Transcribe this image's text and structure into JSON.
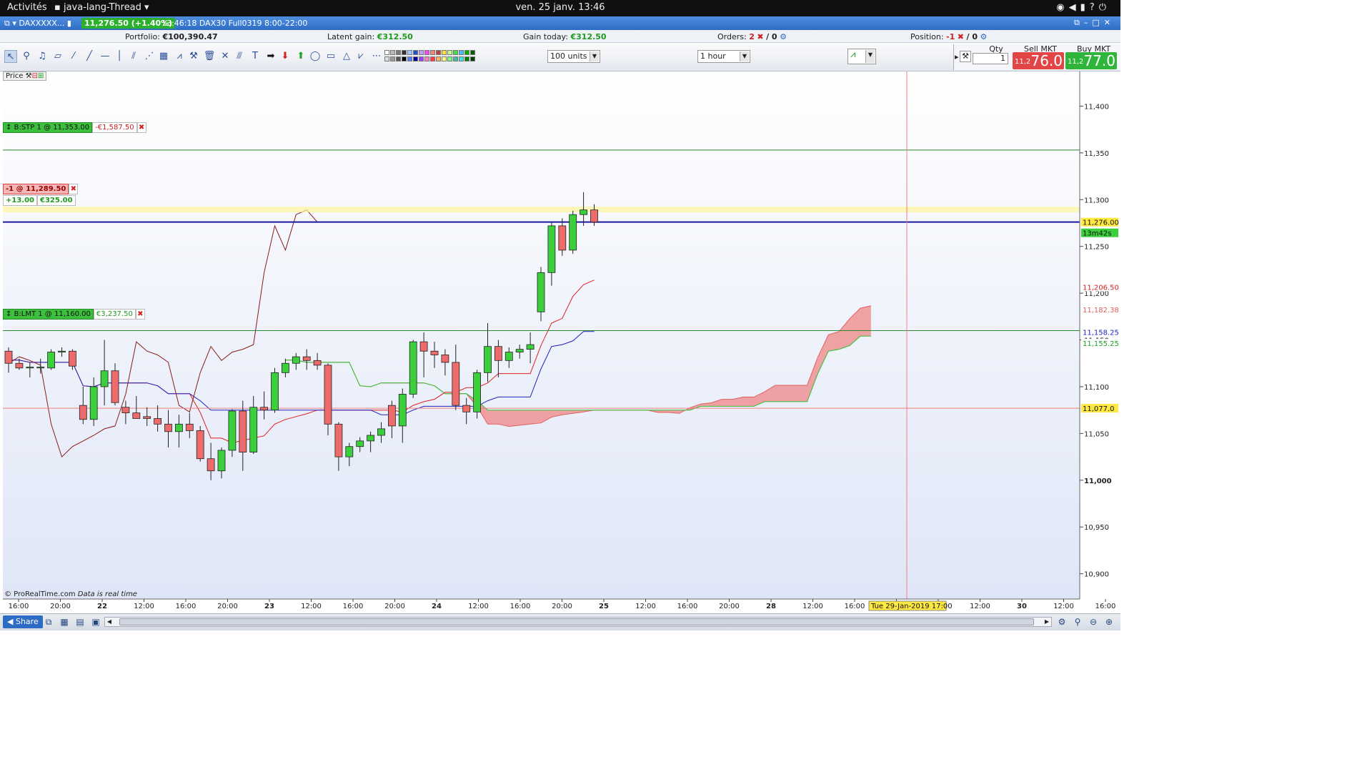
{
  "system": {
    "activities": "Activités",
    "app_name": "java-lang-Thread",
    "clock": "ven. 25 janv.  13:46",
    "tray_icons": [
      "wifi-icon",
      "volume-icon",
      "battery-icon",
      "help-icon",
      "power-icon"
    ]
  },
  "window": {
    "instrument": "DAXXXXX...",
    "price_badge": "11,276.50 (+1.40%)",
    "info": "13:46:18 DAX30 Full0319 8:00-22:00"
  },
  "account": {
    "portfolio_label": "Portfolio:",
    "portfolio_value": "€100,390.47",
    "latent_label": "Latent gain:",
    "latent_value": "€312.50",
    "gain_today_label": "Gain today:",
    "gain_today_value": "€312.50",
    "orders_label": "Orders:",
    "orders_count": "2",
    "orders_sep": "/ 0",
    "position_label": "Position:",
    "position_value": "-1",
    "position_sep": "/ 0"
  },
  "toolbar": {
    "units_select": "100 units",
    "interval_select": "1 hour",
    "qty_label": "Qty",
    "qty_value": "1",
    "sell_label": "Sell MKT",
    "buy_label": "Buy MKT",
    "sell_price_small": "11,2",
    "sell_price_big": "76.0",
    "buy_price_small": "11,2",
    "buy_price_big": "77.0",
    "colors": [
      "#ffffff",
      "#dddddd",
      "#bbbbbb",
      "#999999",
      "#777777",
      "#555555",
      "#333333",
      "#000000",
      "#a0c8ff",
      "#5080ff",
      "#2050d0",
      "#0000a0",
      "#c0a0ff",
      "#a040ff",
      "#ff40ff",
      "#ff80c0",
      "#ff8080",
      "#ff4040",
      "#c04040",
      "#ffb060",
      "#ffe040",
      "#ffff80",
      "#c0ff80",
      "#80ff80",
      "#40e040",
      "#40c0a0",
      "#40c0ff",
      "#40e0e0",
      "#00b000",
      "#008000",
      "#006000",
      "#004000"
    ]
  },
  "price_panel": {
    "label": "Price",
    "footer": "© ProRealTime.com",
    "footer_note": "Data is real time"
  },
  "orders": {
    "stop": {
      "label": "B:STP  1 @ 11,353.00",
      "value": "-€1,587.50"
    },
    "limit": {
      "label": "B:LMT  1 @ 11,160.00",
      "value": "€3,237.50"
    }
  },
  "position": {
    "label": "-1 @ 11,289.50",
    "points": "+13.00",
    "gain": "€325.00"
  },
  "price_labels": {
    "current": "11,276.00",
    "countdown": "13m42s",
    "tenkan": "11,206.50",
    "senkou_a": "11,182.38",
    "kijun": "11,158.25",
    "senkou_b": "11,155.25",
    "crosshair": "11,077.0",
    "date_tooltip": "Tue 29-Jan-2019 17:00"
  },
  "bottombar": {
    "share_label": "Share"
  },
  "chart_data": {
    "type": "candlestick",
    "y_ticks": [
      "11,400",
      "11,350",
      "11,300",
      "11,250",
      "11,200",
      "11,150",
      "11,100",
      "11,050",
      "11,000",
      "10,950",
      "10,900"
    ],
    "y_values": [
      11400,
      11350,
      11300,
      11250,
      11200,
      11150,
      11100,
      11050,
      11000,
      10950,
      10900
    ],
    "ylim": [
      10873,
      11437
    ],
    "x_tick_labels": [
      "16:00",
      "20:00",
      "22",
      "12:00",
      "16:00",
      "20:00",
      "23",
      "12:00",
      "16:00",
      "20:00",
      "24",
      "12:00",
      "16:00",
      "20:00",
      "25",
      "12:00",
      "16:00",
      "20:00",
      "28",
      "12:00",
      "16:00",
      "20:00",
      "29",
      "12:00",
      "30",
      "12:00",
      "16:00"
    ],
    "candles": [
      {
        "o": 11138,
        "h": 11142,
        "l": 11115,
        "c": 11125
      },
      {
        "o": 11125,
        "h": 11130,
        "l": 11118,
        "c": 11120
      },
      {
        "o": 11120,
        "h": 11126,
        "l": 11110,
        "c": 11121
      },
      {
        "o": 11120,
        "h": 11130,
        "l": 11114,
        "c": 11121
      },
      {
        "o": 11120,
        "h": 11140,
        "l": 11118,
        "c": 11137
      },
      {
        "o": 11137,
        "h": 11142,
        "l": 11132,
        "c": 11138
      },
      {
        "o": 11138,
        "h": 11140,
        "l": 11118,
        "c": 11122
      },
      {
        "o": 11080,
        "h": 11100,
        "l": 11060,
        "c": 11065
      },
      {
        "o": 11065,
        "h": 11110,
        "l": 11058,
        "c": 11100
      },
      {
        "o": 11100,
        "h": 11150,
        "l": 11080,
        "c": 11117
      },
      {
        "o": 11117,
        "h": 11125,
        "l": 11080,
        "c": 11083
      },
      {
        "o": 11078,
        "h": 11085,
        "l": 11060,
        "c": 11072
      },
      {
        "o": 11072,
        "h": 11090,
        "l": 11068,
        "c": 11066
      },
      {
        "o": 11068,
        "h": 11078,
        "l": 11058,
        "c": 11066
      },
      {
        "o": 11066,
        "h": 11080,
        "l": 11052,
        "c": 11060
      },
      {
        "o": 11060,
        "h": 11075,
        "l": 11035,
        "c": 11052
      },
      {
        "o": 11052,
        "h": 11070,
        "l": 11035,
        "c": 11060
      },
      {
        "o": 11060,
        "h": 11072,
        "l": 11045,
        "c": 11053
      },
      {
        "o": 11053,
        "h": 11058,
        "l": 11020,
        "c": 11023
      },
      {
        "o": 11023,
        "h": 11040,
        "l": 11000,
        "c": 11010
      },
      {
        "o": 11010,
        "h": 11035,
        "l": 11002,
        "c": 11032
      },
      {
        "o": 11032,
        "h": 11076,
        "l": 11025,
        "c": 11074
      },
      {
        "o": 11074,
        "h": 11085,
        "l": 11010,
        "c": 11030
      },
      {
        "o": 11030,
        "h": 11090,
        "l": 11028,
        "c": 11078
      },
      {
        "o": 11078,
        "h": 11095,
        "l": 11065,
        "c": 11075
      },
      {
        "o": 11075,
        "h": 11120,
        "l": 11072,
        "c": 11115
      },
      {
        "o": 11115,
        "h": 11130,
        "l": 11110,
        "c": 11125
      },
      {
        "o": 11125,
        "h": 11136,
        "l": 11118,
        "c": 11132
      },
      {
        "o": 11132,
        "h": 11140,
        "l": 11118,
        "c": 11128
      },
      {
        "o": 11128,
        "h": 11136,
        "l": 11118,
        "c": 11123
      },
      {
        "o": 11123,
        "h": 11125,
        "l": 11048,
        "c": 11060
      },
      {
        "o": 11060,
        "h": 11062,
        "l": 11010,
        "c": 11025
      },
      {
        "o": 11025,
        "h": 11040,
        "l": 11015,
        "c": 11036
      },
      {
        "o": 11036,
        "h": 11046,
        "l": 11030,
        "c": 11042
      },
      {
        "o": 11042,
        "h": 11052,
        "l": 11030,
        "c": 11048
      },
      {
        "o": 11048,
        "h": 11062,
        "l": 11040,
        "c": 11055
      },
      {
        "o": 11080,
        "h": 11085,
        "l": 11045,
        "c": 11058
      },
      {
        "o": 11058,
        "h": 11098,
        "l": 11040,
        "c": 11092
      },
      {
        "o": 11092,
        "h": 11150,
        "l": 11088,
        "c": 11148
      },
      {
        "o": 11148,
        "h": 11158,
        "l": 11110,
        "c": 11138
      },
      {
        "o": 11138,
        "h": 11148,
        "l": 11120,
        "c": 11134
      },
      {
        "o": 11134,
        "h": 11140,
        "l": 11112,
        "c": 11126
      },
      {
        "o": 11126,
        "h": 11145,
        "l": 11075,
        "c": 11080
      },
      {
        "o": 11080,
        "h": 11088,
        "l": 11060,
        "c": 11073
      },
      {
        "o": 11073,
        "h": 11118,
        "l": 11066,
        "c": 11115
      },
      {
        "o": 11115,
        "h": 11168,
        "l": 11105,
        "c": 11143
      },
      {
        "o": 11143,
        "h": 11150,
        "l": 11110,
        "c": 11128
      },
      {
        "o": 11128,
        "h": 11142,
        "l": 11120,
        "c": 11137
      },
      {
        "o": 11137,
        "h": 11145,
        "l": 11130,
        "c": 11140
      },
      {
        "o": 11140,
        "h": 11158,
        "l": 11125,
        "c": 11145
      },
      {
        "o": 11180,
        "h": 11228,
        "l": 11170,
        "c": 11222
      },
      {
        "o": 11222,
        "h": 11276,
        "l": 11208,
        "c": 11272
      },
      {
        "o": 11272,
        "h": 11280,
        "l": 11240,
        "c": 11246
      },
      {
        "o": 11246,
        "h": 11288,
        "l": 11242,
        "c": 11284
      },
      {
        "o": 11284,
        "h": 11308,
        "l": 11272,
        "c": 11289
      },
      {
        "o": 11289,
        "h": 11295,
        "l": 11272,
        "c": 11276
      }
    ],
    "x_spacing": 14.9,
    "x_start": 12,
    "series": [
      {
        "name": "tenkan",
        "color": "#e02020"
      },
      {
        "name": "kijun",
        "color": "#2020c0"
      },
      {
        "name": "chikou",
        "color": "#8a1a1a"
      },
      {
        "name": "senkou_a",
        "color": "#e06060"
      },
      {
        "name": "senkou_b",
        "color": "#30c030"
      }
    ],
    "order_lines": [
      {
        "name": "stop",
        "value": 11353,
        "color": "#2a8a2a"
      },
      {
        "name": "limit",
        "value": 11160,
        "color": "#2a8a2a"
      },
      {
        "name": "current",
        "value": 11276,
        "color": "#1a1aa0"
      },
      {
        "name": "position",
        "value": 11289.5,
        "color": "#e8e070"
      },
      {
        "name": "crosshair",
        "value": 11077,
        "color": "#f08080"
      }
    ]
  }
}
